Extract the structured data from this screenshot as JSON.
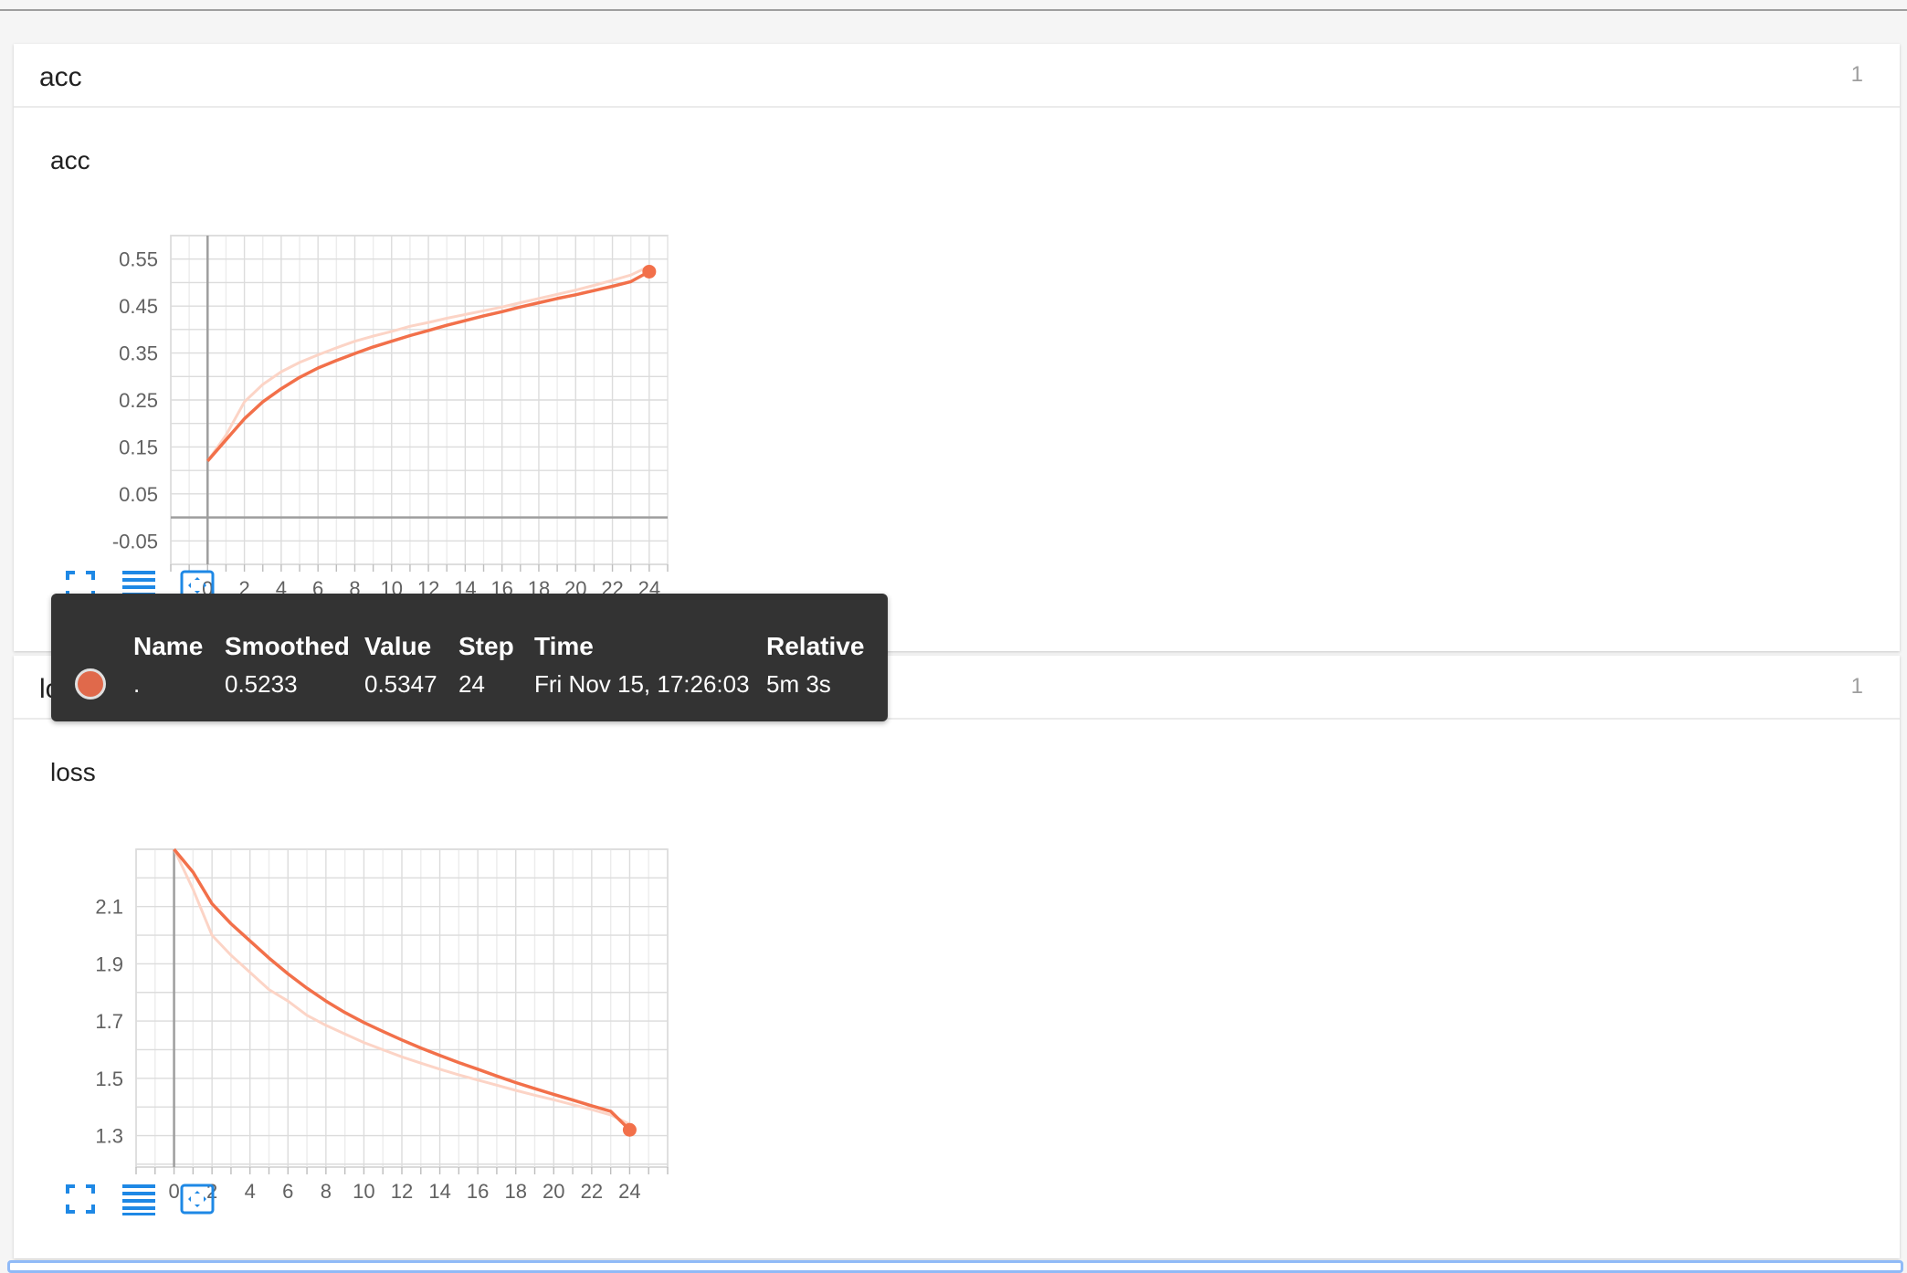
{
  "colors": {
    "series": "#f2704a",
    "series_raw": "#fcd4c6",
    "icon": "#1e88e5",
    "tooltip_bg": "#333333"
  },
  "cards": [
    {
      "title": "acc",
      "count": "1"
    },
    {
      "title": "loss",
      "count": "1"
    }
  ],
  "toolbar_icons": [
    "fit-domain-icon",
    "toggle-log-scale-icon",
    "expand-chart-icon"
  ],
  "tooltip": {
    "headers": {
      "name": "Name",
      "smoothed": "Smoothed",
      "value": "Value",
      "step": "Step",
      "time": "Time",
      "relative": "Relative"
    },
    "row": {
      "name": ".",
      "smoothed": "0.5233",
      "value": "0.5347",
      "step": "24",
      "time": "Fri Nov 15, 17:26:03",
      "relative": "5m 3s"
    }
  },
  "chart_data": [
    {
      "type": "line",
      "title": "acc",
      "x": [
        0,
        1,
        2,
        3,
        4,
        5,
        6,
        7,
        8,
        9,
        10,
        11,
        12,
        13,
        14,
        15,
        16,
        17,
        18,
        19,
        20,
        21,
        22,
        23,
        24
      ],
      "xlim": [
        -2,
        25
      ],
      "ylim": [
        -0.1,
        0.6
      ],
      "xticks": [
        0,
        2,
        4,
        6,
        8,
        10,
        12,
        14,
        16,
        18,
        20,
        22,
        24
      ],
      "yticks": [
        -0.05,
        0.05,
        0.15,
        0.25,
        0.35,
        0.45,
        0.55
      ],
      "ytick_labels": [
        "-0.05",
        "0.05",
        "0.15",
        "0.25",
        "0.35",
        "0.45",
        "0.55"
      ],
      "grid": true,
      "series": [
        {
          "values": [
            0.12,
            0.175,
            0.246,
            0.283,
            0.31,
            0.33,
            0.346,
            0.361,
            0.375,
            0.386,
            0.396,
            0.407,
            0.415,
            0.424,
            0.432,
            0.44,
            0.448,
            0.457,
            0.466,
            0.475,
            0.484,
            0.494,
            0.505,
            0.516,
            0.5347
          ]
        },
        {
          "values": [
            0.12,
            0.165,
            0.21,
            0.246,
            0.274,
            0.298,
            0.318,
            0.334,
            0.349,
            0.363,
            0.375,
            0.387,
            0.398,
            0.409,
            0.419,
            0.429,
            0.438,
            0.448,
            0.457,
            0.466,
            0.474,
            0.483,
            0.492,
            0.502,
            0.5233
          ]
        }
      ]
    },
    {
      "type": "line",
      "title": "loss",
      "x": [
        0,
        1,
        2,
        3,
        4,
        5,
        6,
        7,
        8,
        9,
        10,
        11,
        12,
        13,
        14,
        15,
        16,
        17,
        18,
        19,
        20,
        21,
        22,
        23,
        24
      ],
      "xlim": [
        -2,
        26
      ],
      "ylim": [
        1.19,
        2.3
      ],
      "xticks": [
        0,
        2,
        4,
        6,
        8,
        10,
        12,
        14,
        16,
        18,
        20,
        22,
        24
      ],
      "yticks": [
        1.3,
        1.5,
        1.7,
        1.9,
        2.1
      ],
      "ytick_labels": [
        "1.3",
        "1.5",
        "1.7",
        "1.9",
        "2.1"
      ],
      "grid": true,
      "series": [
        {
          "values": [
            2.3,
            2.16,
            2.0,
            1.93,
            1.87,
            1.81,
            1.77,
            1.72,
            1.685,
            1.655,
            1.625,
            1.6,
            1.575,
            1.553,
            1.532,
            1.512,
            1.494,
            1.476,
            1.458,
            1.441,
            1.425,
            1.408,
            1.391,
            1.372,
            1.34
          ]
        },
        {
          "values": [
            2.3,
            2.22,
            2.11,
            2.04,
            1.98,
            1.92,
            1.865,
            1.815,
            1.77,
            1.73,
            1.695,
            1.664,
            1.634,
            1.606,
            1.58,
            1.555,
            1.532,
            1.508,
            1.485,
            1.464,
            1.444,
            1.424,
            1.404,
            1.385,
            1.32
          ]
        }
      ]
    }
  ]
}
